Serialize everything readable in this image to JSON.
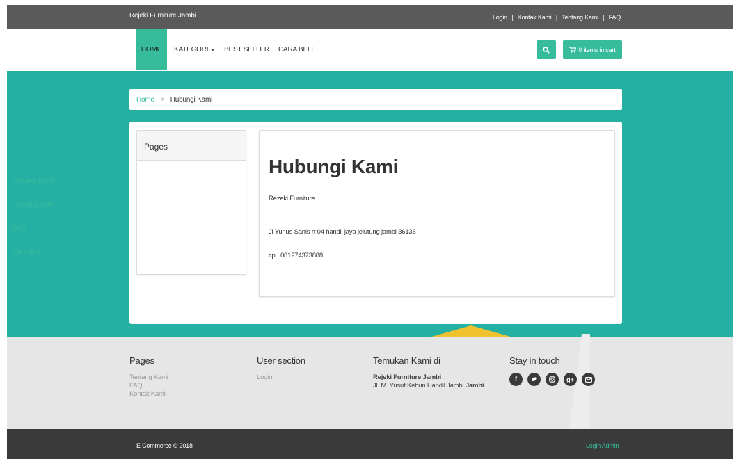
{
  "topbar": {
    "brand": "Rejeki Furniture Jambi",
    "links": [
      "Login",
      "Kontak Kami",
      "Tentang Kami",
      "FAQ"
    ],
    "separator": "|"
  },
  "nav": {
    "items": [
      {
        "label": "HOME",
        "active": true
      },
      {
        "label": "KATEGORI",
        "dropdown": true
      },
      {
        "label": "BEST SELLER"
      },
      {
        "label": "CARA BELI"
      }
    ],
    "cart_label": "0 items in cart",
    "search_icon": "search-icon",
    "cart_icon": "cart-icon",
    "accent": "#37bc9b"
  },
  "breadcrumb": {
    "home": "Home",
    "separator": ">",
    "current": "Hubungi Kami"
  },
  "sidebar": {
    "title": "Pages",
    "links": [
      "Tentang Kami",
      "Hubungi Kami",
      "FAQ",
      "Cara Beli"
    ]
  },
  "main": {
    "title": "Hubungi Kami",
    "company": "Rezeki Furniture",
    "address": "Jl Yunus Sanis rt 04 handil jaya jelutung jambi 36136",
    "phone": "cp : 081274373888"
  },
  "footer": {
    "pages_title": "Pages",
    "pages_links": [
      "Tentang Kami",
      "FAQ",
      "Kontak Kami"
    ],
    "user_title": "User section",
    "user_links": [
      "Login"
    ],
    "find_title": "Temukan Kami di",
    "find_name": "Rejeki Furniture Jambi",
    "find_address": "Jl. M. Yusuf Kebun Handil Jambi",
    "find_city": "Jambi",
    "touch_title": "Stay in touch",
    "social_icons": [
      "facebook-icon",
      "twitter-icon",
      "instagram-icon",
      "google-plus-icon",
      "email-icon"
    ]
  },
  "bottombar": {
    "copyright": "E Commerce © 2018",
    "login_admin": "Login Admin"
  },
  "colors": {
    "accent": "#37bc9b",
    "hero": "#25b0a4",
    "topbar": "#5a5a5a",
    "bottombar": "#3a3a3a"
  }
}
